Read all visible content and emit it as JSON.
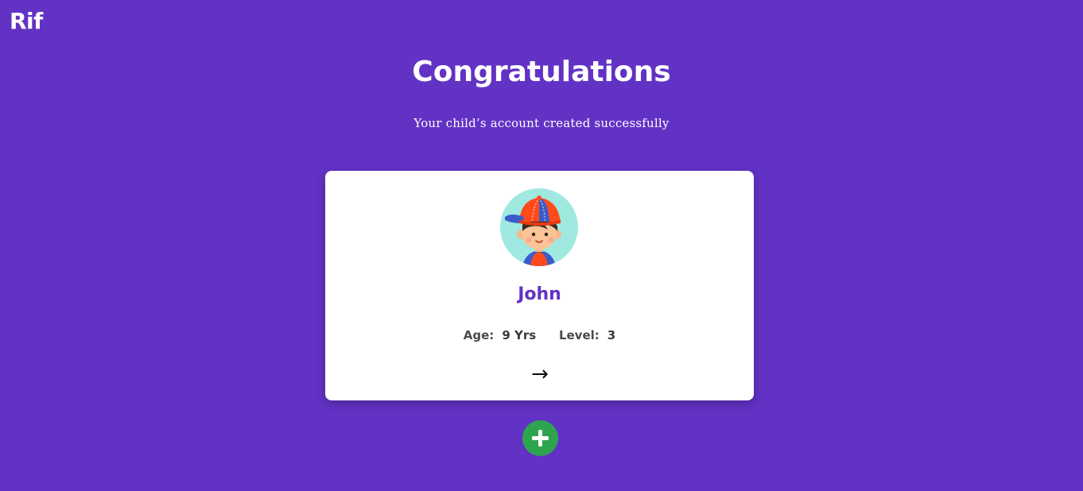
{
  "brand": {
    "logo_text": "Rif"
  },
  "header": {
    "title": "Congratulations",
    "subtitle": "Your child’s account created successfully"
  },
  "child_card": {
    "name": "John",
    "age_label": "Age:",
    "age_value": "9 Yrs",
    "level_label": "Level:",
    "level_value": "3",
    "next_icon": "arrow-right-icon",
    "avatar_icon": "child-avatar-cap-boy"
  },
  "add_button": {
    "icon": "plus-icon"
  },
  "colors": {
    "background": "#6232c5",
    "card": "#ffffff",
    "accent_name": "#6232c5",
    "add_button": "#2ea44f",
    "avatar_bg": "#9fe9e0"
  }
}
